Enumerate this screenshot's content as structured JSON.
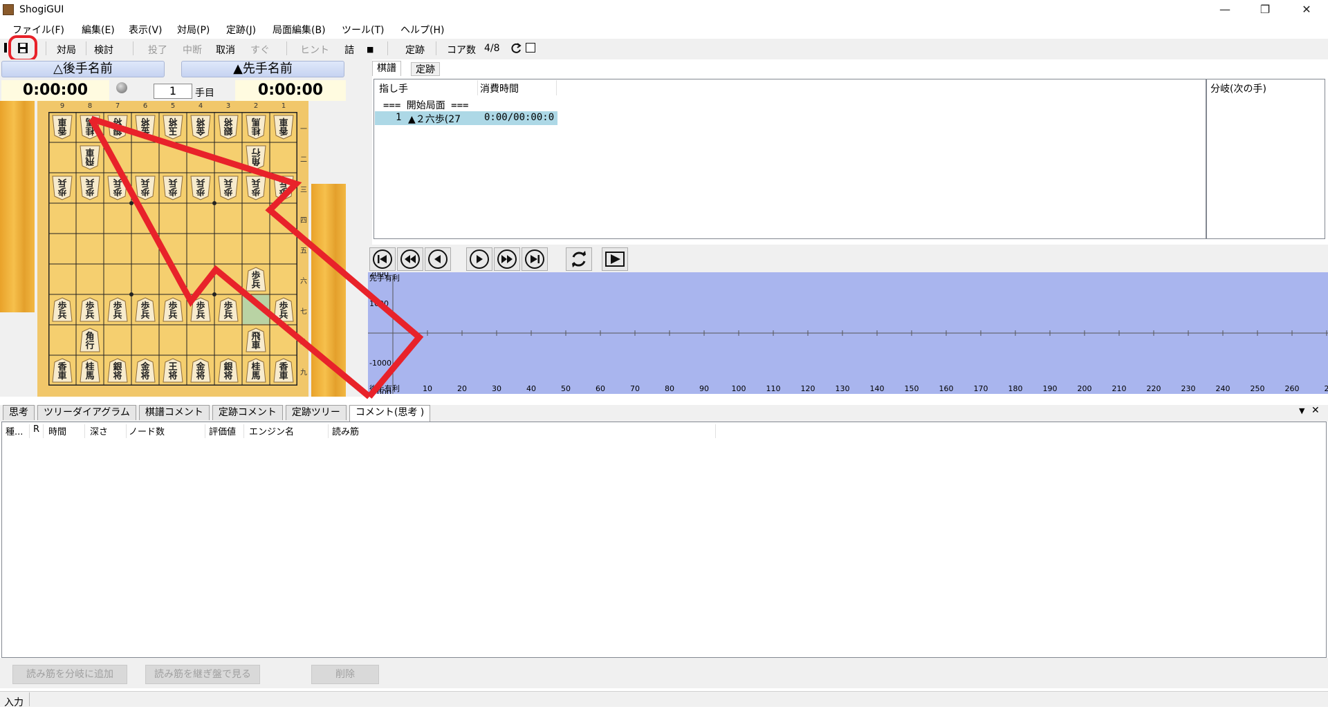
{
  "window": {
    "title": "ShogiGUI",
    "minimize": "—",
    "maximize": "❐",
    "close": "✕"
  },
  "menu": [
    "ファイル(F)",
    "編集(E)",
    "表示(V)",
    "対局(P)",
    "定跡(J)",
    "局面編集(B)",
    "ツール(T)",
    "ヘルプ(H)"
  ],
  "toolbar": {
    "play": "対局",
    "analyze": "検討",
    "resign": "投了",
    "pause": "中断",
    "undo": "取消",
    "now": "すぐ",
    "hint": "ヒント",
    "tsume": "詰",
    "stop": "■",
    "joseki": "定跡",
    "cores_label": "コア数",
    "cores_value": "4/8"
  },
  "players": {
    "gote": "△後手名前",
    "sente": "▲先手名前",
    "gote_time": "0:00:00",
    "sente_time": "0:00:00"
  },
  "move_number": {
    "value": "1",
    "label": "手目"
  },
  "board": {
    "files": [
      "9",
      "8",
      "7",
      "6",
      "5",
      "4",
      "3",
      "2",
      "1"
    ],
    "ranks": [
      "一",
      "二",
      "三",
      "四",
      "五",
      "六",
      "七",
      "八",
      "九"
    ],
    "white": [
      {
        "f": 9,
        "r": 1,
        "k": "香車"
      },
      {
        "f": 8,
        "r": 1,
        "k": "桂馬"
      },
      {
        "f": 7,
        "r": 1,
        "k": "銀将"
      },
      {
        "f": 6,
        "r": 1,
        "k": "金将"
      },
      {
        "f": 5,
        "r": 1,
        "k": "玉将"
      },
      {
        "f": 4,
        "r": 1,
        "k": "金将"
      },
      {
        "f": 3,
        "r": 1,
        "k": "銀将"
      },
      {
        "f": 2,
        "r": 1,
        "k": "桂馬"
      },
      {
        "f": 1,
        "r": 1,
        "k": "香車"
      },
      {
        "f": 8,
        "r": 2,
        "k": "飛車"
      },
      {
        "f": 2,
        "r": 2,
        "k": "角行"
      },
      {
        "f": 9,
        "r": 3,
        "k": "歩兵"
      },
      {
        "f": 8,
        "r": 3,
        "k": "歩兵"
      },
      {
        "f": 7,
        "r": 3,
        "k": "歩兵"
      },
      {
        "f": 6,
        "r": 3,
        "k": "歩兵"
      },
      {
        "f": 5,
        "r": 3,
        "k": "歩兵"
      },
      {
        "f": 4,
        "r": 3,
        "k": "歩兵"
      },
      {
        "f": 3,
        "r": 3,
        "k": "歩兵"
      },
      {
        "f": 2,
        "r": 3,
        "k": "歩兵"
      },
      {
        "f": 1,
        "r": 3,
        "k": "歩兵"
      }
    ],
    "black": [
      {
        "f": 2,
        "r": 6,
        "k": "歩兵",
        "last": true
      },
      {
        "f": 9,
        "r": 7,
        "k": "歩兵"
      },
      {
        "f": 8,
        "r": 7,
        "k": "歩兵"
      },
      {
        "f": 7,
        "r": 7,
        "k": "歩兵"
      },
      {
        "f": 6,
        "r": 7,
        "k": "歩兵"
      },
      {
        "f": 5,
        "r": 7,
        "k": "歩兵"
      },
      {
        "f": 4,
        "r": 7,
        "k": "歩兵"
      },
      {
        "f": 3,
        "r": 7,
        "k": "歩兵"
      },
      {
        "f": 1,
        "r": 7,
        "k": "歩兵"
      },
      {
        "f": 8,
        "r": 8,
        "k": "角行"
      },
      {
        "f": 2,
        "r": 8,
        "k": "飛車"
      },
      {
        "f": 9,
        "r": 9,
        "k": "香車"
      },
      {
        "f": 8,
        "r": 9,
        "k": "桂馬"
      },
      {
        "f": 7,
        "r": 9,
        "k": "銀将"
      },
      {
        "f": 6,
        "r": 9,
        "k": "金将"
      },
      {
        "f": 5,
        "r": 9,
        "k": "王将"
      },
      {
        "f": 4,
        "r": 9,
        "k": "金将"
      },
      {
        "f": 3,
        "r": 9,
        "k": "銀将"
      },
      {
        "f": 2,
        "r": 9,
        "k": "桂馬"
      },
      {
        "f": 1,
        "r": 9,
        "k": "香車"
      }
    ],
    "from_square": {
      "f": 2,
      "r": 7
    }
  },
  "kifu": {
    "tabs": [
      "棋譜",
      "定跡"
    ],
    "col_move": "指し手",
    "col_time": "消費時間",
    "start_row": "=== 開始局面 ===",
    "rows": [
      {
        "num": "1",
        "move": "▲２六歩(27",
        "time": "0:00/00:00:0"
      }
    ],
    "branch_title": "分岐(次の手)"
  },
  "graph": {
    "title": "先手有利",
    "bottom_label": "後手有利",
    "y_ticks": [
      "2000",
      "1000",
      "-1000",
      "-2000"
    ],
    "x_ticks": [
      "10",
      "20",
      "30",
      "40",
      "50",
      "60",
      "70",
      "80",
      "90",
      "100",
      "110",
      "120",
      "130",
      "140",
      "150",
      "160",
      "170",
      "180",
      "190",
      "200",
      "210",
      "220",
      "230",
      "240",
      "250",
      "260",
      "2"
    ]
  },
  "bottom_tabs": [
    "思考",
    "ツリーダイアグラム",
    "棋譜コメント",
    "定跡コメント",
    "定跡ツリー",
    "コメント(思考 )"
  ],
  "think_columns": [
    "種...",
    "R",
    "時間",
    "深さ",
    "ノード数",
    "評価値",
    "エンジン名",
    "読み筋"
  ],
  "buttons": {
    "add_branch": "読み筋を分岐に追加",
    "continue_board": "読み筋を継ぎ盤で見る",
    "delete": "削除"
  },
  "status": "入力",
  "colors": {
    "annotation_red": "#e8222a",
    "graph_bg": "#a9b5ee",
    "highlight_row": "#add8e6"
  }
}
